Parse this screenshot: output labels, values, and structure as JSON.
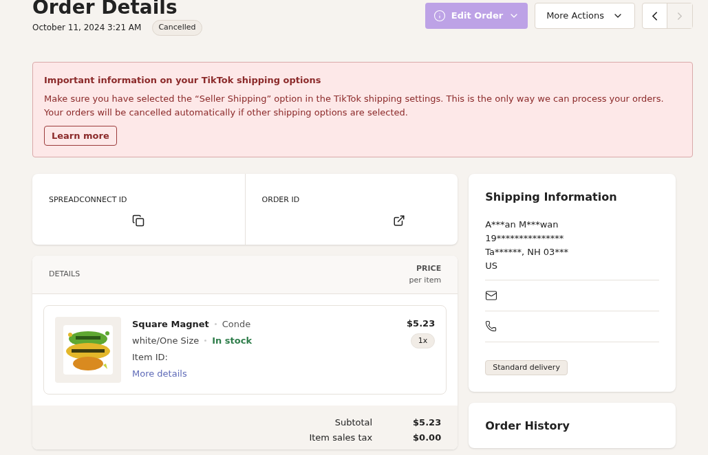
{
  "header": {
    "title": "Order Details",
    "date": "October 11, 2024 3:21 AM",
    "status": "Cancelled"
  },
  "actions": {
    "edit_order": {
      "label": "Edit Order",
      "disabled": true
    },
    "more_actions": {
      "label": "More Actions"
    },
    "prev": {
      "disabled": false
    },
    "next": {
      "disabled": true
    }
  },
  "alert": {
    "title": "Important information on your TikTok shipping options",
    "body": "Make sure you have selected the “Seller Shipping” option in the TikTok shipping settings. This is the only way we can process your orders. Your orders will be cancelled automatically if other shipping options are selected.",
    "button": "Learn more"
  },
  "ids": [
    {
      "label": "SPREADCONNECT ID",
      "kind": "copy"
    },
    {
      "label": "ORDER ID",
      "kind": "external"
    }
  ],
  "details": {
    "column_1": "DETAILS",
    "price_heading": "PRICE",
    "price_sub": "per item",
    "items": [
      {
        "kind": "picture",
        "name": "Square Magnet",
        "brand": "Conde",
        "variant": "white/One Size",
        "stock": "In stock",
        "item_id_label": "Item ID:",
        "link": "More details",
        "price": "$5.23",
        "quantity": "1x"
      }
    ],
    "totals": [
      {
        "label": "Subtotal",
        "value": "$5.23"
      },
      {
        "label": "Item sales tax",
        "value": "$0.00"
      }
    ]
  },
  "shipping": {
    "title": "Shipping Information",
    "name": "A***an M***wan",
    "lines": [
      "19***************",
      "Ta******, NH 03***",
      "US"
    ],
    "contacts": [
      {
        "kind": "email"
      },
      {
        "kind": "phone"
      }
    ],
    "delivery": "Standard delivery"
  },
  "history": {
    "title": "Order History"
  }
}
